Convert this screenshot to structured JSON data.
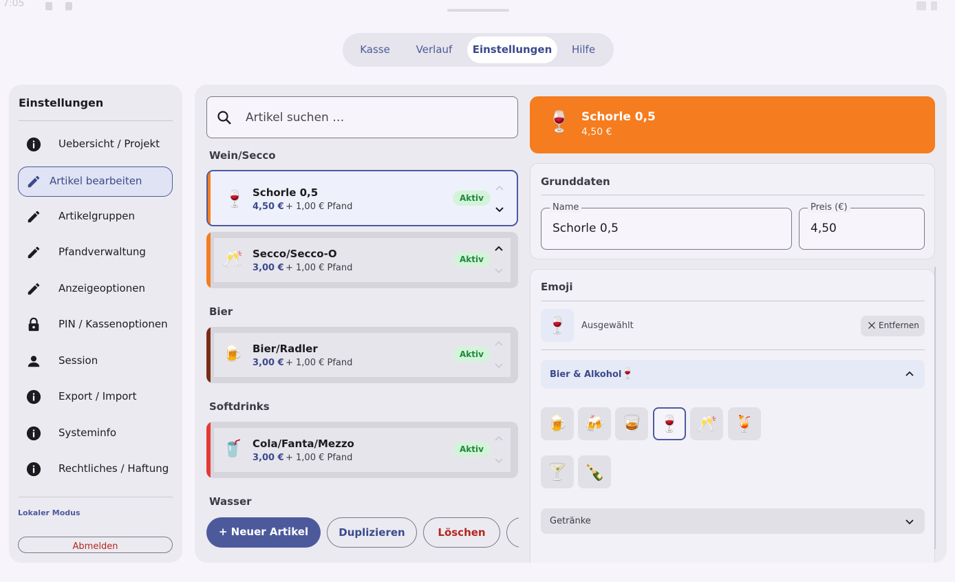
{
  "status_bar": {
    "time": "7:05"
  },
  "tabs": [
    {
      "label": "Kasse",
      "active": false
    },
    {
      "label": "Verlauf",
      "active": false
    },
    {
      "label": "Einstellungen",
      "active": true
    },
    {
      "label": "Hilfe",
      "active": false
    }
  ],
  "sidebar": {
    "title": "Einstellungen",
    "items": [
      {
        "label": "Uebersicht / Projekt",
        "icon": "info-icon"
      },
      {
        "label": "Artikel bearbeiten",
        "icon": "pencil-icon",
        "active": true
      },
      {
        "label": "Artikelgruppen",
        "icon": "pencil-icon"
      },
      {
        "label": "Pfandverwaltung",
        "icon": "pencil-icon"
      },
      {
        "label": "Anzeigeoptionen",
        "icon": "pencil-icon"
      },
      {
        "label": "PIN / Kassenoptionen",
        "icon": "lock-icon"
      },
      {
        "label": "Session",
        "icon": "person-icon"
      },
      {
        "label": "Export / Import",
        "icon": "info-icon"
      },
      {
        "label": "Systeminfo",
        "icon": "info-icon"
      },
      {
        "label": "Rechtliches / Haftung",
        "icon": "info-icon"
      }
    ],
    "mode": "Lokaler Modus",
    "logout": "Abmelden"
  },
  "search": {
    "placeholder": "Artikel suchen …"
  },
  "groups": [
    {
      "label": "Wein/Secco"
    },
    {
      "label": "Bier"
    },
    {
      "label": "Softdrinks"
    },
    {
      "label": "Wasser"
    }
  ],
  "articles": [
    {
      "emoji": "🍷",
      "name": "Schorle 0,5",
      "price": "4,50 €",
      "deposit": "+ 1,00 € Pfand",
      "status": "Aktiv",
      "color": "#f57c1f"
    },
    {
      "emoji": "🥂",
      "name": "Secco/Secco-O",
      "price": "3,00 €",
      "deposit": "+ 1,00 € Pfand",
      "status": "Aktiv",
      "color": "#f57c1f"
    },
    {
      "emoji": "🍺",
      "name": "Bier/Radler",
      "price": "3,00 €",
      "deposit": "+ 1,00 € Pfand",
      "status": "Aktiv",
      "color": "#7a2c14"
    },
    {
      "emoji": "🥤",
      "name": "Cola/Fanta/Mezzo",
      "price": "3,00 €",
      "deposit": "+ 1,00 € Pfand",
      "status": "Aktiv",
      "color": "#e53935"
    }
  ],
  "actions": {
    "new": "+ Neuer Artikel",
    "duplicate": "Duplizieren",
    "delete": "Löschen"
  },
  "detail": {
    "emoji": "🍷",
    "name": "Schorle 0,5",
    "price": "4,50 €",
    "accent": "#f57c1f",
    "basics": {
      "title": "Grunddaten",
      "name_label": "Name",
      "name_value": "Schorle 0,5",
      "price_label": "Preis (€)",
      "price_value": "4,50"
    },
    "emoji_section": {
      "title": "Emoji",
      "selected_label": "Ausgewählt",
      "remove_label": "Entfernen",
      "category_open": {
        "label": "Bier & Alkohol",
        "emoji": "🍷"
      },
      "emoji_options": [
        "🍺",
        "🍻",
        "🥃",
        "🍷",
        "🥂",
        "🍹",
        "🍸",
        "🍾"
      ],
      "category_closed": {
        "label": "Getränke"
      }
    }
  }
}
